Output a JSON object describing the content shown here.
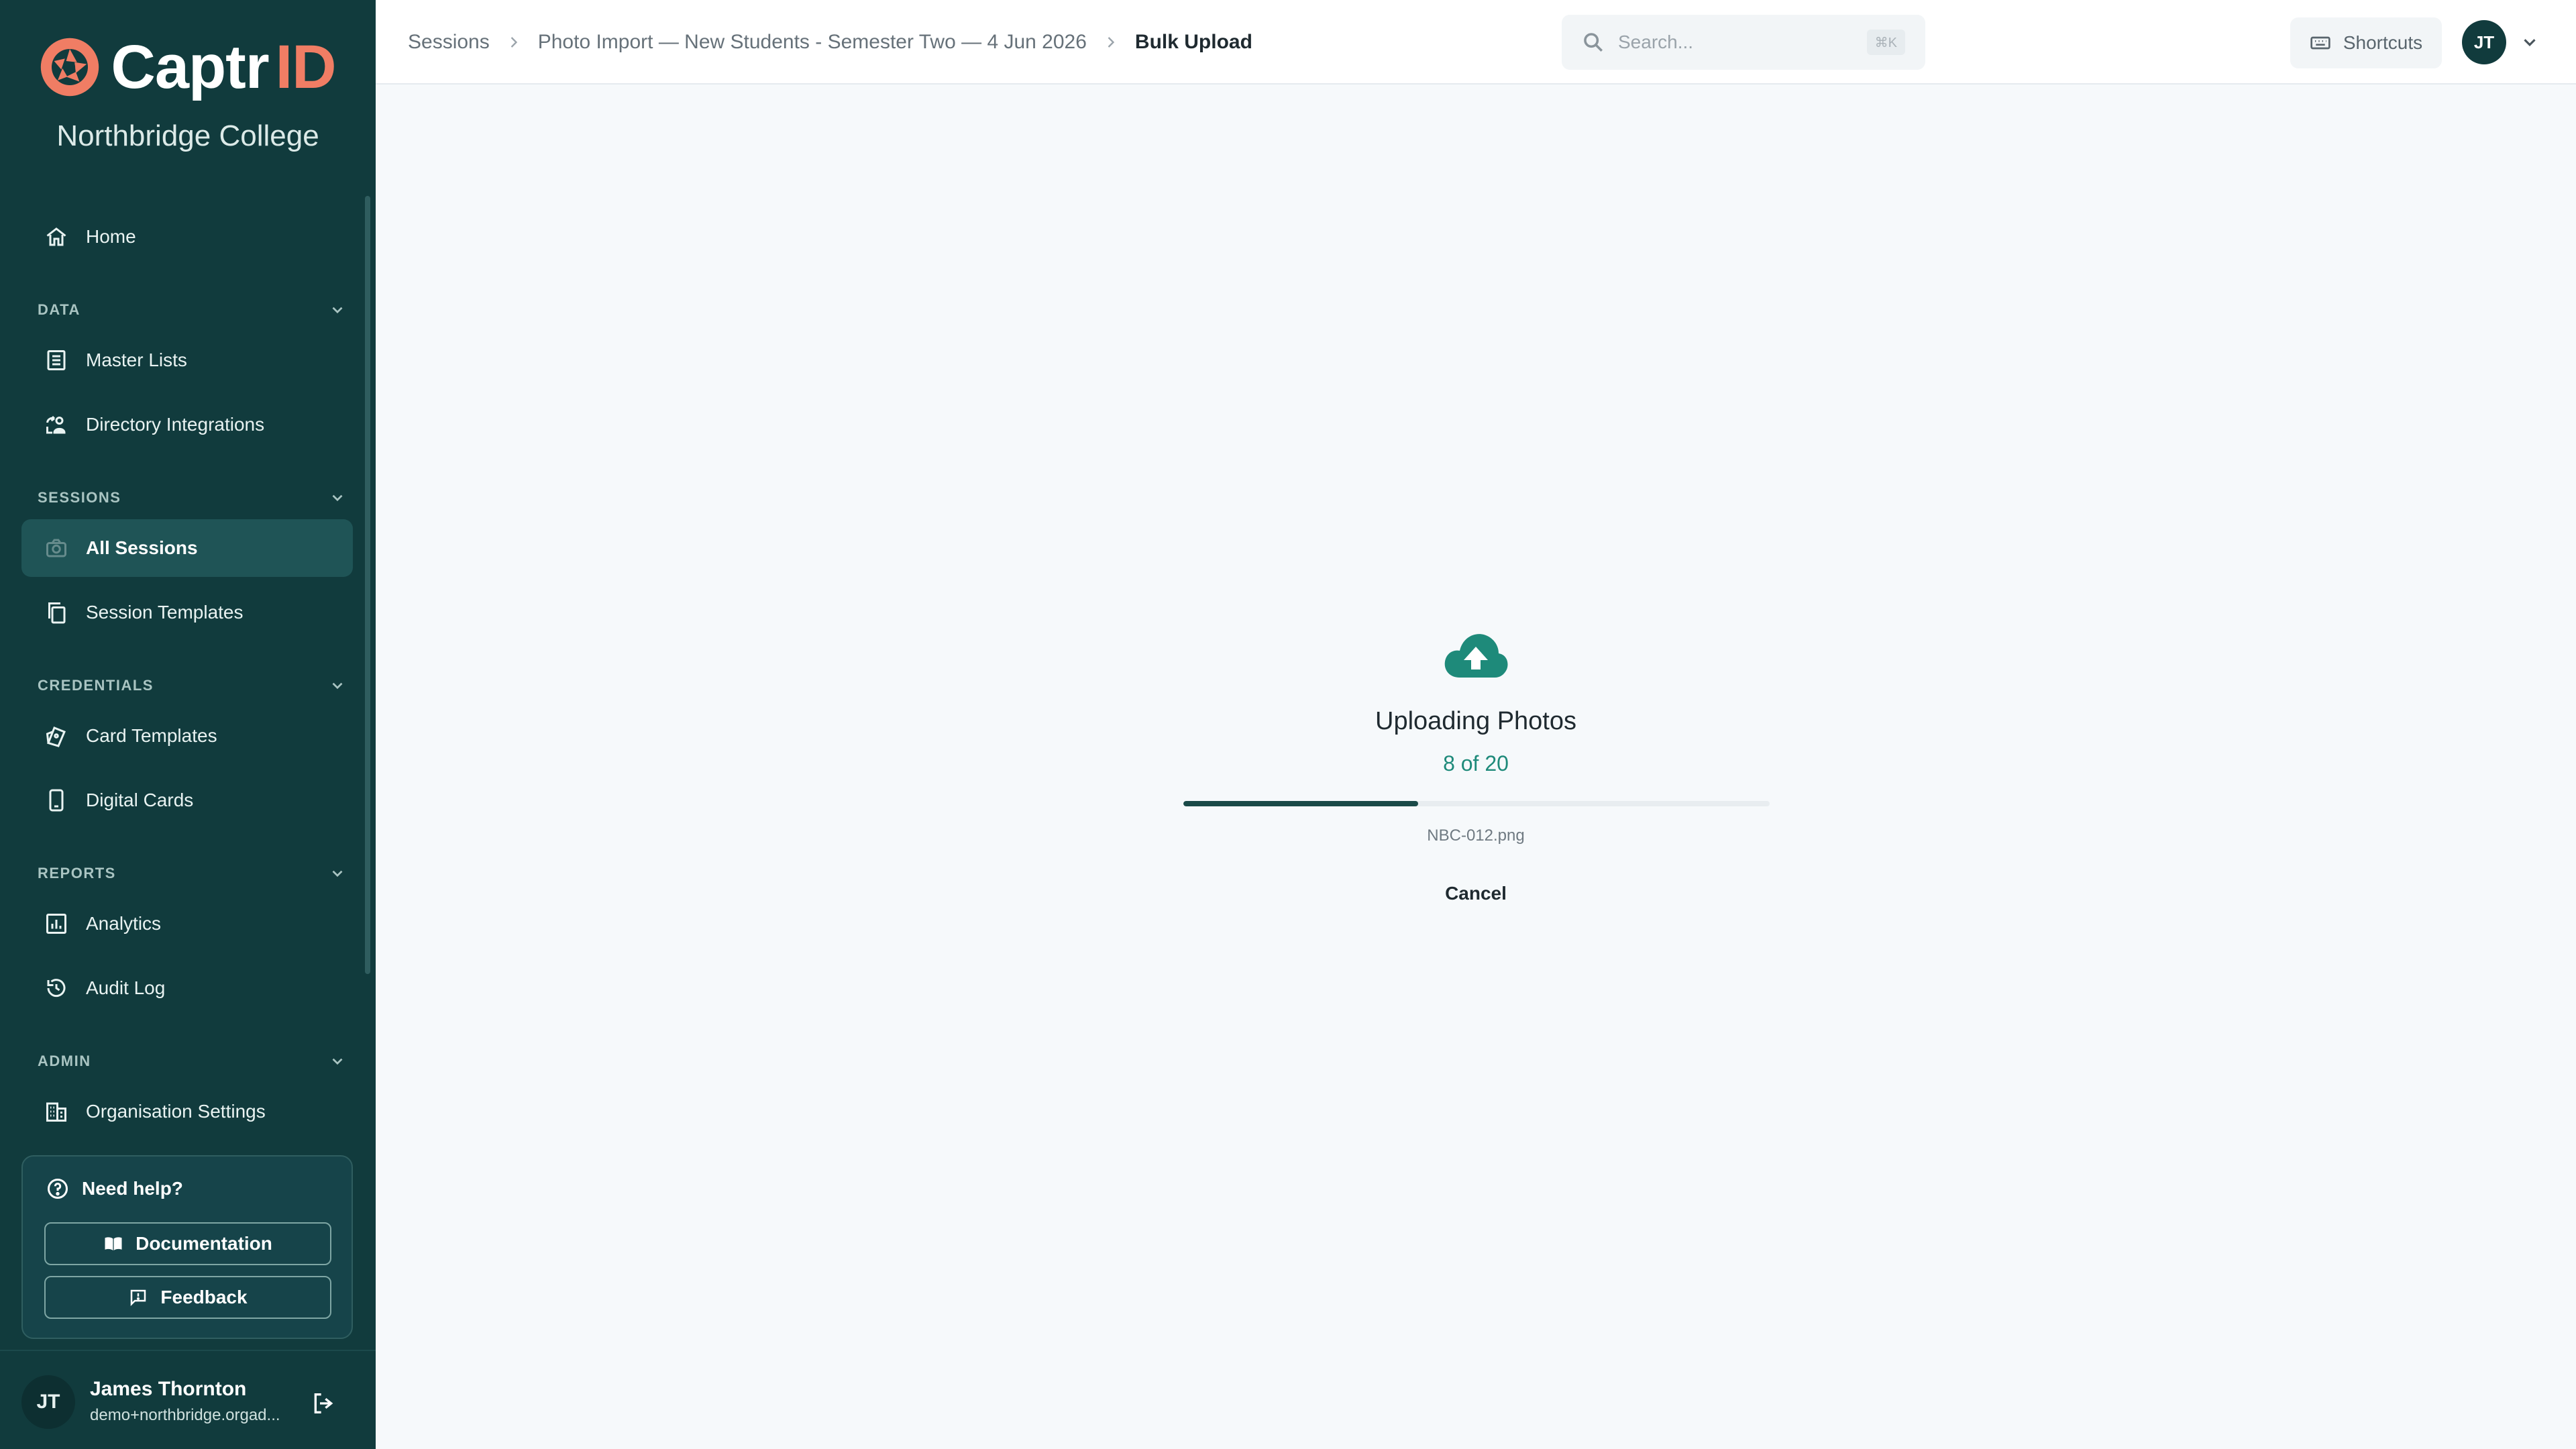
{
  "brand": {
    "name_part1": "Captr",
    "name_part2": "ID",
    "org_name": "Northbridge College",
    "accent_color": "#f07d64",
    "sidebar_color": "#113b3d"
  },
  "sidebar": {
    "home": {
      "label": "Home",
      "icon": "home-icon"
    },
    "sections": [
      {
        "title": "DATA",
        "items": [
          {
            "label": "Master Lists",
            "icon": "list-icon"
          },
          {
            "label": "Directory Integrations",
            "icon": "directory-sync-icon"
          }
        ]
      },
      {
        "title": "SESSIONS",
        "items": [
          {
            "label": "All Sessions",
            "icon": "camera-icon",
            "active": true
          },
          {
            "label": "Session Templates",
            "icon": "copy-icon"
          }
        ]
      },
      {
        "title": "CREDENTIALS",
        "items": [
          {
            "label": "Card Templates",
            "icon": "cards-icon"
          },
          {
            "label": "Digital Cards",
            "icon": "phone-icon"
          }
        ]
      },
      {
        "title": "REPORTS",
        "items": [
          {
            "label": "Analytics",
            "icon": "analytics-icon"
          },
          {
            "label": "Audit Log",
            "icon": "history-icon"
          }
        ]
      },
      {
        "title": "ADMIN",
        "items": [
          {
            "label": "Organisation Settings",
            "icon": "building-icon"
          }
        ]
      }
    ],
    "help": {
      "title": "Need help?",
      "documentation_label": "Documentation",
      "feedback_label": "Feedback"
    },
    "user": {
      "initials": "JT",
      "name": "James Thornton",
      "email": "demo+northbridge.orgad..."
    }
  },
  "topbar": {
    "breadcrumbs": [
      "Sessions",
      "Photo Import — New Students - Semester Two — 4 Jun 2026",
      "Bulk Upload"
    ],
    "search_placeholder": "Search...",
    "search_shortcut": "⌘K",
    "shortcuts_label": "Shortcuts",
    "avatar_initials": "JT"
  },
  "upload": {
    "title": "Uploading Photos",
    "count_text": "8 of 20",
    "current": 8,
    "total": 20,
    "file_name": "NBC-012.png",
    "cancel_label": "Cancel",
    "accent_color": "#1e8a7a"
  }
}
